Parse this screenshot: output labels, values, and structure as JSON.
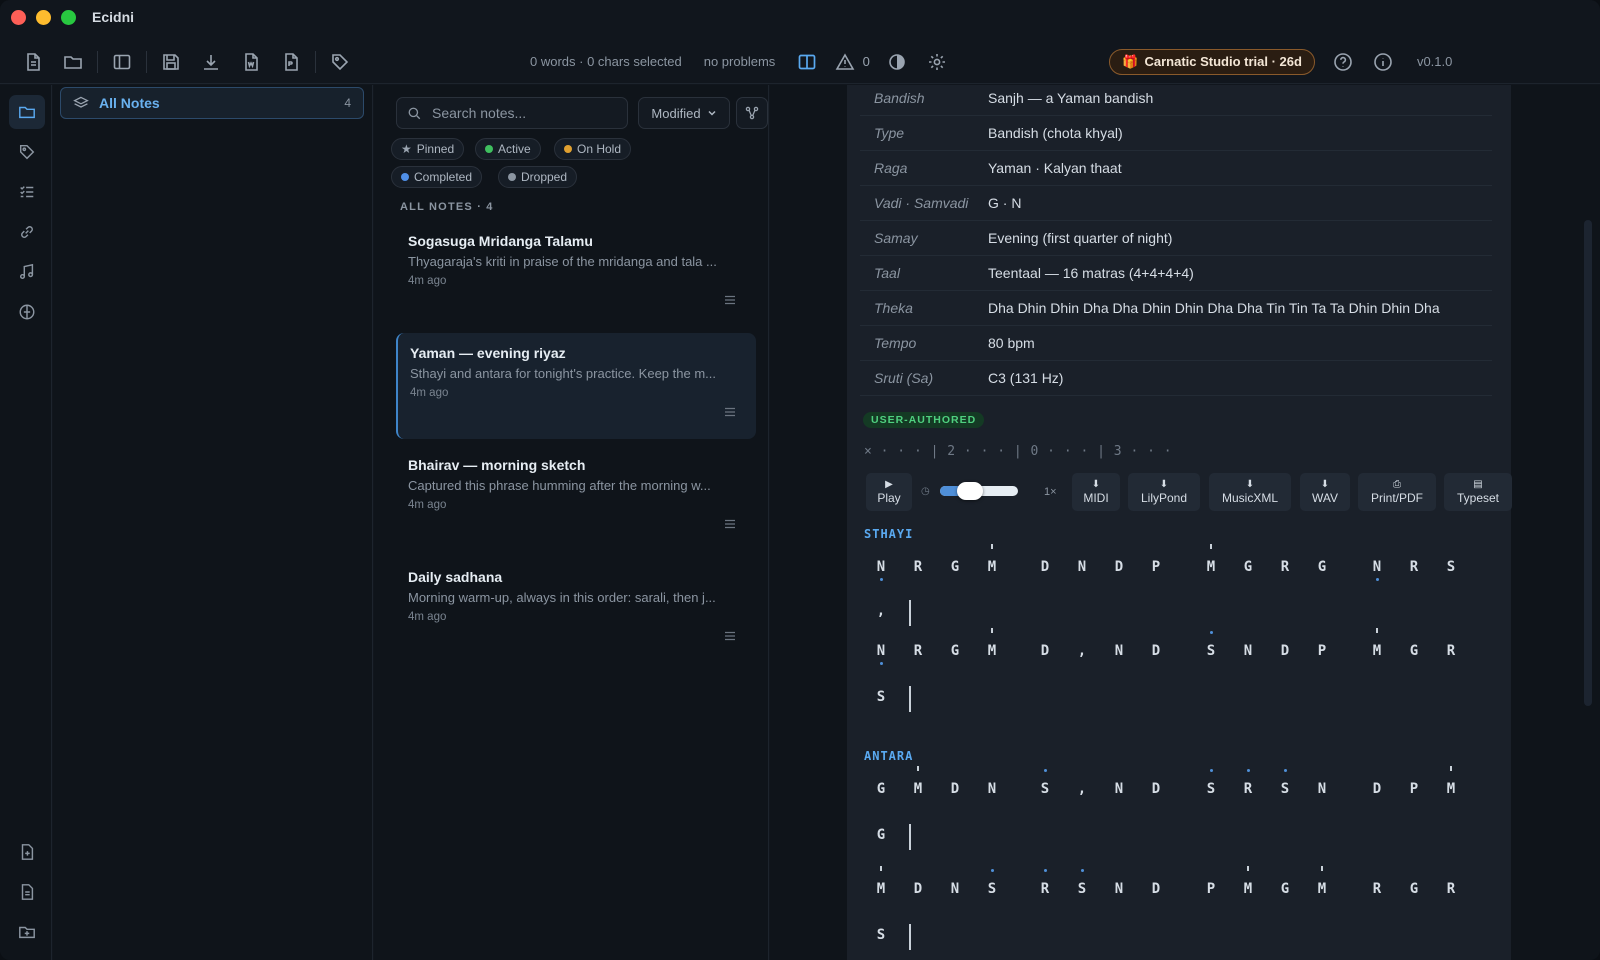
{
  "app": {
    "title": "Ecidni",
    "version": "v0.1.0"
  },
  "toolbar": {
    "icons": [
      "new-note-icon",
      "open-folder-icon",
      "sidebar-toggle-icon",
      "save-icon",
      "download-icon",
      "export-word-icon",
      "export-pdf-icon",
      "tag-icon"
    ],
    "word_count": "0 words · 0 chars selected",
    "problems": "no problems",
    "warnings_count": "0",
    "trial_badge": "Carnatic Studio trial · 26d"
  },
  "rail": {
    "top": [
      "folders-icon",
      "tags-icon",
      "list-icon",
      "link-icon",
      "music-icon",
      "compass-icon"
    ],
    "bottom": [
      "add-file-icon",
      "document-icon",
      "add-folder-icon"
    ]
  },
  "folders": {
    "all_notes_label": "All Notes",
    "all_notes_count": "4"
  },
  "notes": {
    "search_placeholder": "Search notes...",
    "sort_label": "Modified",
    "filters": [
      {
        "label": "Pinned",
        "color": "#9aa4b0"
      },
      {
        "label": "Active",
        "color": "#3fbf5f"
      },
      {
        "label": "On Hold",
        "color": "#e0a030"
      },
      {
        "label": "Completed",
        "color": "#4f8fe8"
      },
      {
        "label": "Dropped",
        "color": "#8b95a1"
      }
    ],
    "section_header": "ALL NOTES · 4",
    "items": [
      {
        "title": "Sogasuga Mridanga Talamu",
        "snippet": "Thyagaraja's kriti in praise of the mridanga and tala ...",
        "time": "4m ago"
      },
      {
        "title": "Yaman — evening riyaz",
        "snippet": "Sthayi and antara for tonight's practice. Keep the m...",
        "time": "4m ago"
      },
      {
        "title": "Bhairav — morning sketch",
        "snippet": "Captured this phrase humming after the morning w...",
        "time": "4m ago"
      },
      {
        "title": "Daily sadhana",
        "snippet": "Morning warm-up, always in this order: sarali, then j...",
        "time": "4m ago"
      }
    ]
  },
  "doc": {
    "meta": [
      {
        "k": "Bandish",
        "v": "Sanjh — a Yaman bandish"
      },
      {
        "k": "Type",
        "v": "Bandish (chota khyal)"
      },
      {
        "k": "Raga",
        "v": "Yaman · Kalyan thaat"
      },
      {
        "k": "Vadi · Samvadi",
        "v": "G · N"
      },
      {
        "k": "Samay",
        "v": "Evening (first quarter of night)"
      },
      {
        "k": "Taal",
        "v": "Teentaal — 16 matras (4+4+4+4)"
      },
      {
        "k": "Theka",
        "v": "Dha Dhin Dhin Dha Dha Dhin Dhin Dha Dha Tin Tin Ta Ta Dhin Dhin Dha"
      },
      {
        "k": "Tempo",
        "v": "80 bpm"
      },
      {
        "k": "Sruti (Sa)",
        "v": "C3 (131 Hz)"
      }
    ],
    "badge": "USER-AUTHORED",
    "ruler": "× · · · | 2 · · · | 0 · · · | 3 · · ·",
    "player": {
      "play": "Play",
      "speed": "1×",
      "buttons": [
        "MIDI",
        "LilyPond",
        "MusicXML",
        "WAV",
        "Print/PDF",
        "Typeset"
      ]
    },
    "sections": {
      "sthayi": "STHAYI",
      "antara": "ANTARA"
    }
  }
}
